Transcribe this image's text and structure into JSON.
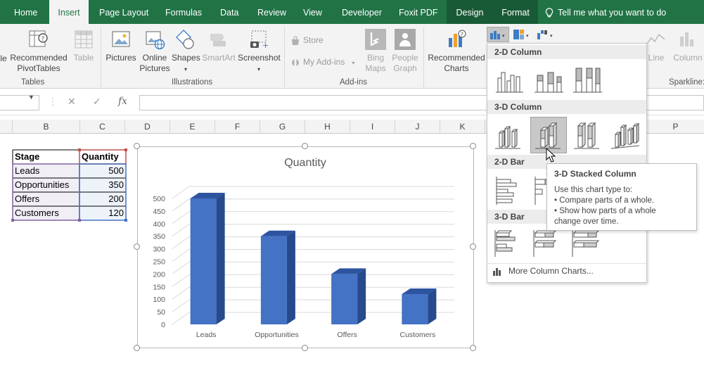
{
  "tabs": [
    {
      "label": "Home",
      "state": "normal"
    },
    {
      "label": "Insert",
      "state": "active"
    },
    {
      "label": "Page Layout",
      "state": "normal"
    },
    {
      "label": "Formulas",
      "state": "normal"
    },
    {
      "label": "Data",
      "state": "normal"
    },
    {
      "label": "Review",
      "state": "normal"
    },
    {
      "label": "View",
      "state": "normal"
    },
    {
      "label": "Developer",
      "state": "normal"
    },
    {
      "label": "Foxit PDF",
      "state": "normal"
    },
    {
      "label": "Design",
      "state": "contextual"
    },
    {
      "label": "Format",
      "state": "contextual"
    }
  ],
  "tell_me": "Tell me what you want to do",
  "ribbon": {
    "tables": {
      "pivot_partial": "le",
      "recommended_pivot_line1": "Recommended",
      "recommended_pivot_line2": "PivotTables",
      "table": "Table",
      "group": "Tables"
    },
    "illustrations": {
      "pictures": "Pictures",
      "online_line1": "Online",
      "online_line2": "Pictures",
      "shapes": "Shapes",
      "smartart": "SmartArt",
      "screenshot": "Screenshot",
      "group": "Illustrations"
    },
    "addins": {
      "store": "Store",
      "my_addins": "My Add-ins",
      "bing_line1": "Bing",
      "bing_line2": "Maps",
      "people_line1": "People",
      "people_line2": "Graph",
      "group": "Add-ins"
    },
    "charts": {
      "recommended_line1": "Recommended",
      "recommended_line2": "Charts"
    },
    "sparklines": {
      "line": "Line",
      "column": "Column",
      "group": "Sparkline:"
    }
  },
  "formula_bar": {
    "name_box": "",
    "cancel": "✕",
    "enter": "✓",
    "fx": "fx",
    "value": ""
  },
  "columns": [
    "B",
    "C",
    "D",
    "E",
    "F",
    "G",
    "H",
    "I",
    "J",
    "K",
    "P"
  ],
  "table": {
    "header": {
      "stage": "Stage",
      "quantity": "Quantity"
    },
    "rows": [
      {
        "stage": "Leads",
        "quantity": "500"
      },
      {
        "stage": "Opportunities",
        "quantity": "350"
      },
      {
        "stage": "Offers",
        "quantity": "200"
      },
      {
        "stage": "Customers",
        "quantity": "120"
      }
    ]
  },
  "chart_data": {
    "type": "bar",
    "title": "Quantity",
    "categories": [
      "Leads",
      "Opportunities",
      "Offers",
      "Customers"
    ],
    "values": [
      500,
      350,
      200,
      120
    ],
    "yticks": [
      "0",
      "50",
      "100",
      "150",
      "200",
      "250",
      "300",
      "350",
      "400",
      "450",
      "500"
    ],
    "ylim": [
      0,
      500
    ],
    "grid": true,
    "bar_color": "#4472c4",
    "bar_top_color": "#2e54a0",
    "bar_side_color": "#264a8c"
  },
  "dropdown": {
    "sections": {
      "col2d": "2-D Column",
      "col3d": "3-D Column",
      "bar2d": "2-D Bar",
      "bar3d": "3-D Bar"
    },
    "more": "More Column Charts..."
  },
  "tooltip": {
    "title": "3-D Stacked Column",
    "line1": "Use this chart type to:",
    "line2": "• Compare parts of a whole.",
    "line3": "• Show how parts of a whole",
    "line4": "change over time."
  },
  "colors": {
    "excel_green": "#217346",
    "context_green": "#195a36",
    "table_header_border": "#c0504d",
    "table_selection_border": "#8064a2",
    "table_value_border": "#4472c4"
  }
}
